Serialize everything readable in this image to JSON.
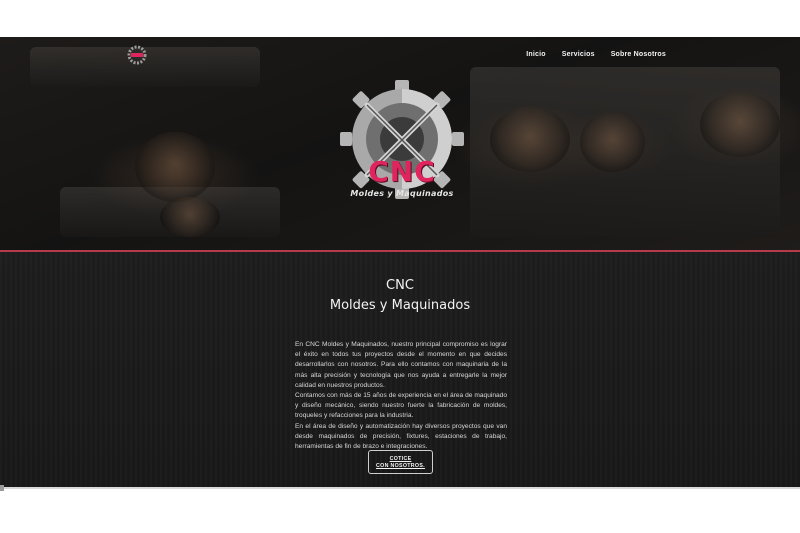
{
  "nav": {
    "items": [
      {
        "label": "Inicio"
      },
      {
        "label": "Servicios"
      },
      {
        "label": "Sobre Nosotros"
      }
    ]
  },
  "hero": {
    "logo_title": "CNC",
    "logo_subtitle": "Moldes y Maquinados"
  },
  "intro": {
    "title_line1": "CNC",
    "title_line2": "Moldes y Maquinados",
    "paragraphs": [
      "En CNC Moldes y Maquinados, nuestro principal compromiso es lograr el éxito en todos tus proyectos desde el momento en que decides desarrollarlos con nosotros. Para ello contamos con maquinaria de la más alta precisión y tecnología que nos ayuda a entregarle la mejor calidad en nuestros productos.",
      "Contamos con más de 15 años de experiencia en el área de maquinado y diseño mecánico, siendo nuestro fuerte la fabricación de moldes, troqueles y refacciones para la industria.",
      "En el área de diseño y automatización hay diversos proyectos que van desde maquinados de precisión, fixtures, estaciones de trabajo, herramientas de fin de brazo e integraciones."
    ]
  },
  "cta": {
    "line1": "COTICE",
    "line2": "CON NOSOTROS."
  },
  "colors": {
    "accent": "#e0245e",
    "divider": "#b43a4c",
    "background": "#1b1b1b"
  }
}
